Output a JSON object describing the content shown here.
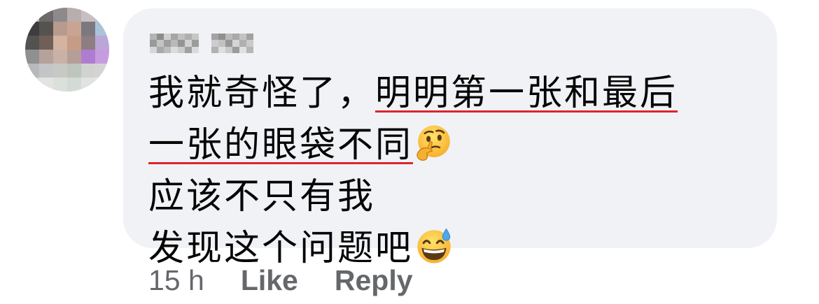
{
  "author": {
    "name": "Sara Yip",
    "blurred": true
  },
  "comment": {
    "segments": {
      "s1": "我就奇怪了，",
      "s2": "明明第一张和最后",
      "s3": "一张的眼袋不同",
      "s4": "应该不只有我",
      "s5": "发现这个问题吧"
    },
    "highlight_color": "#e0242b",
    "emojis": [
      "thinking-face",
      "grinning-face-with-sweat"
    ]
  },
  "meta": {
    "time": "15 h",
    "like_label": "Like",
    "reply_label": "Reply"
  },
  "colors": {
    "bubble": "#f0f2f5",
    "text": "#050505",
    "meta_text": "#65676b"
  }
}
